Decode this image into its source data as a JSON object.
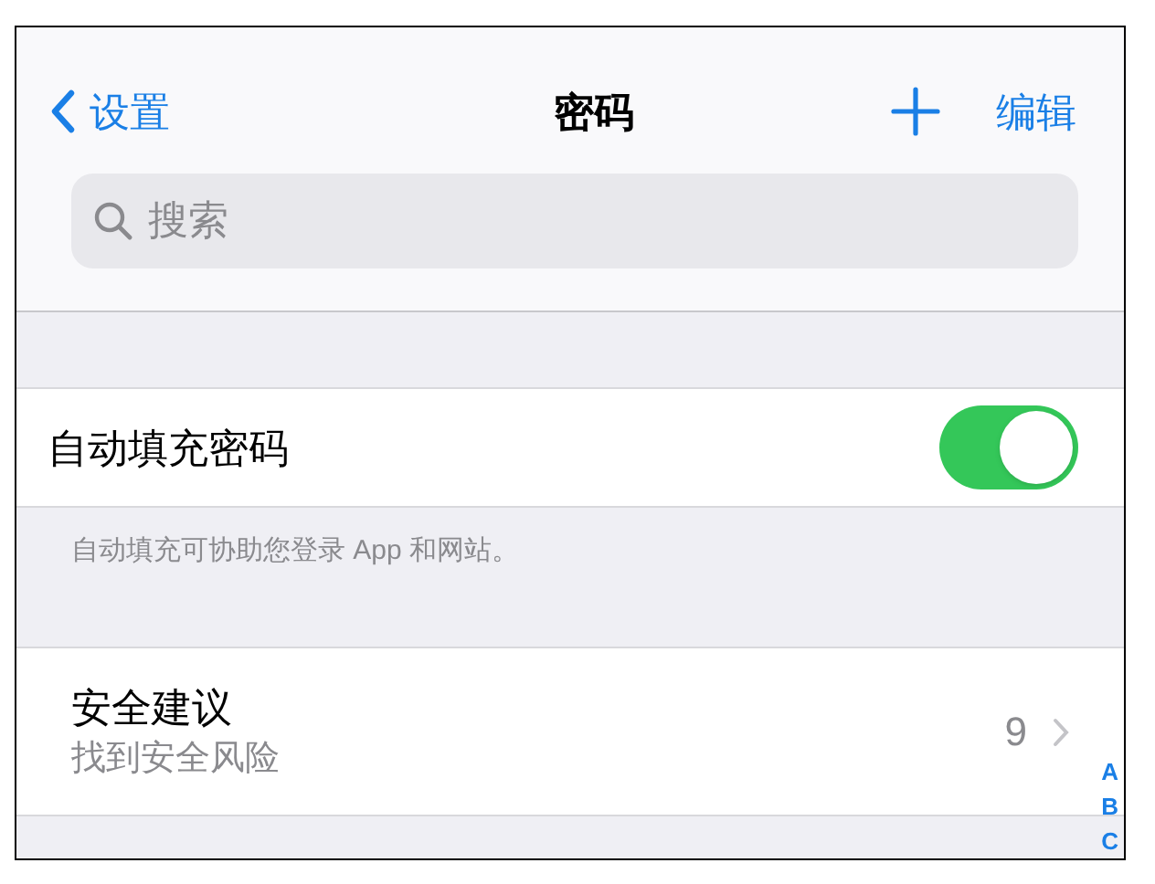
{
  "nav_bar": {
    "back_label": "设置",
    "title": "密码",
    "edit_label": "编辑"
  },
  "search": {
    "placeholder": "搜索"
  },
  "autofill": {
    "label": "自动填充密码",
    "on": true
  },
  "autofill_footer": "自动填充可协助您登录 App 和网站。",
  "security_recommendations": {
    "title": "安全建议",
    "subtitle": "找到安全风险",
    "count": "9"
  },
  "index_letters": [
    "A",
    "B",
    "C"
  ]
}
